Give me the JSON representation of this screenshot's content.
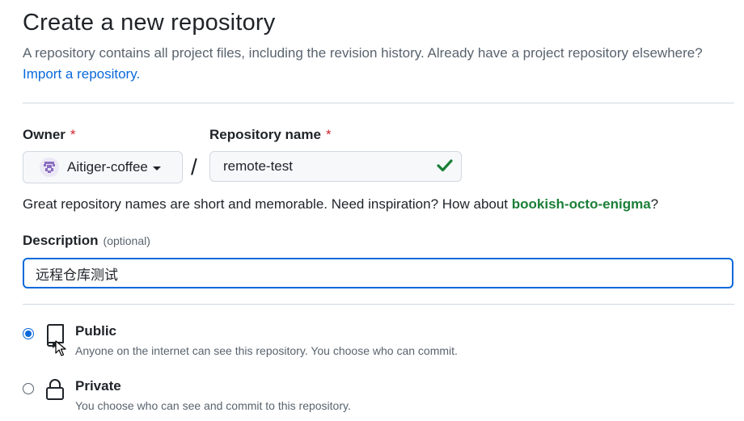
{
  "page": {
    "title": "Create a new repository",
    "subtitle": "A repository contains all project files, including the revision history. Already have a project repository elsewhere?",
    "import_link": "Import a repository."
  },
  "owner": {
    "label": "Owner",
    "required_mark": "*",
    "value": "Aitiger-coffee"
  },
  "separator": "/",
  "repo_name": {
    "label": "Repository name",
    "required_mark": "*",
    "value": "remote-test",
    "valid": true
  },
  "hint": {
    "text": "Great repository names are short and memorable. Need inspiration? How about",
    "suggestion": "bookish-octo-enigma",
    "suffix": "?"
  },
  "description": {
    "label": "Description",
    "optional": "(optional)",
    "value": "远程仓库测试"
  },
  "visibility": {
    "selected": "public",
    "options": [
      {
        "id": "public",
        "title": "Public",
        "desc": "Anyone on the internet can see this repository. You choose who can commit.",
        "icon": "repo-icon"
      },
      {
        "id": "private",
        "title": "Private",
        "desc": "You choose who can see and commit to this repository.",
        "icon": "lock-icon"
      }
    ]
  },
  "colors": {
    "accent": "#0969da",
    "success": "#1a7f37",
    "danger": "#d1242f"
  }
}
